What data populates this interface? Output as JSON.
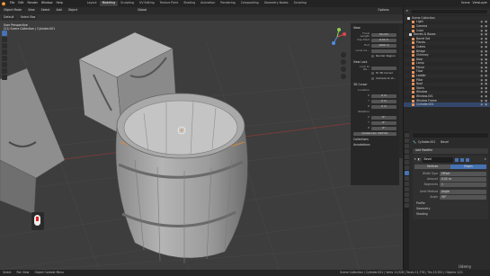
{
  "menubar": {
    "items": [
      "File",
      "Edit",
      "Render",
      "Window",
      "Help"
    ],
    "workspaces": [
      "Layout",
      "Modeling",
      "Sculpting",
      "UV Editing",
      "Texture Paint",
      "Shading",
      "Animation",
      "Rendering",
      "Compositing",
      "Geometry Nodes",
      "Scripting"
    ],
    "active_workspace": "Modeling",
    "scene_name": "Scene",
    "view_layer": "ViewLayer"
  },
  "viewport_header": {
    "mode": "Object Mode",
    "menus": [
      "View",
      "Select",
      "Add",
      "Object"
    ],
    "orientation": "Global",
    "pivot": "Default",
    "drag": "Select Box",
    "options": "Options"
  },
  "viewport_info": {
    "view_name": "User Perspective",
    "object_info": "(21) Scene Collection | Cylinder.001"
  },
  "npanel": {
    "view_header": "View",
    "focal_label": "Focal Length",
    "focal_value": "50 mm",
    "clip_start_label": "Clip Start",
    "clip_start_value": "0.01 m",
    "clip_end_label": "End",
    "clip_end_value": "1000 m",
    "local_camera_label": "Local Ca...",
    "render_region": "Render Region",
    "view_lock_label": "View Lock",
    "lock_to_obj_label": "Lock to Ob...",
    "lock_3d_cursor": "To 3D Cursor",
    "camera_to_view": "Camera to Vi...",
    "cursor_header": "3D Cursor",
    "location_label": "Location",
    "loc_x": "0 m",
    "loc_y": "0 m",
    "loc_z": "0 m",
    "rotation_label": "Rotation",
    "rot_x": "0°",
    "rot_y": "0°",
    "rot_z": "0°",
    "rotation_mode": "Quaternion (WXYZ)",
    "collections_header": "Collections",
    "annotations_header": "Annotations"
  },
  "outliner": {
    "title": "Scene Collection",
    "rows": [
      {
        "name": "Light",
        "type": "obj"
      },
      {
        "name": "Camera",
        "type": "obj"
      },
      {
        "name": "Cube",
        "type": "obj"
      },
      {
        "name": "Barrels & Boxes",
        "type": "coll"
      },
      {
        "name": "Barrel Set",
        "type": "obj"
      },
      {
        "name": "Planks",
        "type": "obj"
      },
      {
        "name": "Crates",
        "type": "obj"
      },
      {
        "name": "Bridge",
        "type": "obj"
      },
      {
        "name": "Chimney",
        "type": "obj"
      },
      {
        "name": "Door",
        "type": "obj"
      },
      {
        "name": "Lamp",
        "type": "obj"
      },
      {
        "name": "Fence",
        "type": "obj"
      },
      {
        "name": "Floor",
        "type": "obj"
      },
      {
        "name": "Ladder",
        "type": "obj"
      },
      {
        "name": "Pillar",
        "type": "obj"
      },
      {
        "name": "Roof",
        "type": "obj"
      },
      {
        "name": "Stairs",
        "type": "obj"
      },
      {
        "name": "Window",
        "type": "obj"
      },
      {
        "name": "Window.001",
        "type": "obj"
      },
      {
        "name": "Window Frame",
        "type": "obj"
      },
      {
        "name": "Cylinder.001",
        "type": "obj"
      }
    ]
  },
  "properties": {
    "object_name": "Cylinder.001",
    "sub_name": "Bevel",
    "add_modifier": "Add Modifier",
    "modifier_name": "Bevel",
    "seg_vertices": "Vertices",
    "seg_edges": "Edges",
    "width_type_label": "Width Type",
    "width_type": "Offset",
    "amount_label": "Amount",
    "amount": "0.02 m",
    "segments_label": "Segments",
    "segments": "1",
    "limit_method_label": "Limit Method",
    "limit_method": "Angle",
    "angle_label": "Angle",
    "angle": "30°",
    "sections": [
      "Profile",
      "Geometry",
      "Shading"
    ]
  },
  "statusbar": {
    "select": "Select",
    "pan": "Pan View",
    "context": "Object Context Menu",
    "stats": "Scene Collection | Cylinder.001 | Verts 11,928 | Faces 11,776 | Tris 23,552 | Objects 1/21",
    "watermark": "Udemy"
  }
}
